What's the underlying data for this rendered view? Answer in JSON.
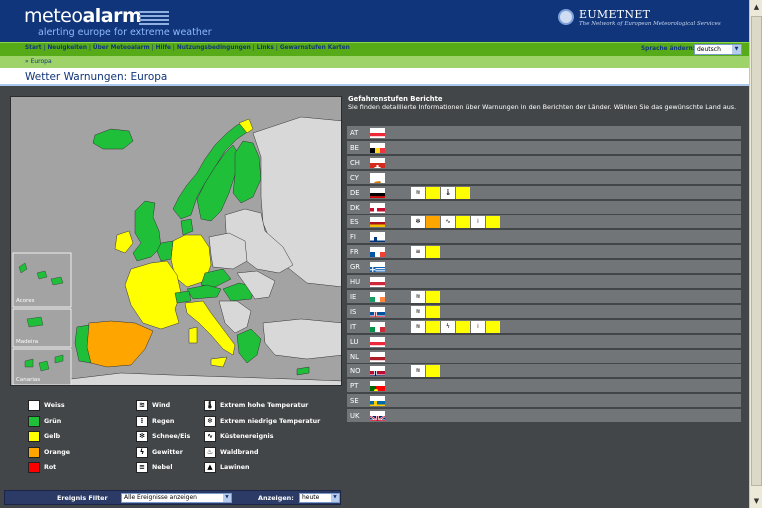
{
  "header": {
    "logo_part1": "meteo",
    "logo_part2": "alarm",
    "tagline": "alerting europe for extreme weather",
    "partner_name": "EUMETNET",
    "partner_sub": "The Network of European Meteorological Services"
  },
  "nav": {
    "items": [
      "Start",
      "Neuigkeiten",
      "Über Meteoalarm",
      "Hilfe",
      "Nutzungsbedingungen",
      "Links",
      "Gewarnstufen Karten"
    ],
    "language_label": "Sprache ändern:",
    "language_value": "deutsch"
  },
  "breadcrumb": "» Europa",
  "page_title": "Wetter Warnungen: Europa",
  "map": {
    "inset_labels": [
      "Acores",
      "Madeira",
      "Canarias"
    ]
  },
  "legend": {
    "levels": [
      {
        "label": "Weiss",
        "color": "#ffffff"
      },
      {
        "label": "Grün",
        "color": "#1fbf3a"
      },
      {
        "label": "Gelb",
        "color": "#ffff00"
      },
      {
        "label": "Orange",
        "color": "#ffa500"
      },
      {
        "label": "Rot",
        "color": "#ff0000"
      }
    ],
    "events_col1": [
      {
        "label": "Wind",
        "icon": "wind-icon"
      },
      {
        "label": "Regen",
        "icon": "rain-icon"
      },
      {
        "label": "Schnee/Eis",
        "icon": "snow-ice-icon"
      },
      {
        "label": "Gewitter",
        "icon": "thunderstorm-icon"
      },
      {
        "label": "Nebel",
        "icon": "fog-icon"
      }
    ],
    "events_col2": [
      {
        "label": "Extrem hohe Temperatur",
        "icon": "high-temp-icon"
      },
      {
        "label": "Extrem niedrige Temperatur",
        "icon": "low-temp-icon"
      },
      {
        "label": "Küstenereignis",
        "icon": "coastal-icon"
      },
      {
        "label": "Waldbrand",
        "icon": "forest-fire-icon"
      },
      {
        "label": "Lawinen",
        "icon": "avalanche-icon"
      }
    ]
  },
  "filter": {
    "label": "Ereignis Filter",
    "value": "Alle Ereignisse anzeigen",
    "show_label": "Anzeigen:",
    "show_value": "heute"
  },
  "reports": {
    "title": "Gefahrenstufen Berichte",
    "description": "Sie finden detaillierte Informationen über Warnungen in den Berichten der Länder. Wählen Sie das gewünschte Land aus.",
    "countries": [
      {
        "code": "AT",
        "flag": "austria-flag",
        "warnings": []
      },
      {
        "code": "BE",
        "flag": "belgium-flag",
        "warnings": []
      },
      {
        "code": "CH",
        "flag": "switzerland-flag",
        "warnings": []
      },
      {
        "code": "CY",
        "flag": "cyprus-flag",
        "warnings": []
      },
      {
        "code": "DE",
        "flag": "germany-flag",
        "warnings": [
          {
            "icon": "wind-icon",
            "level": "#ffff00"
          },
          {
            "icon": "high-temp-icon",
            "level": "#ffff00"
          }
        ]
      },
      {
        "code": "DK",
        "flag": "denmark-flag",
        "warnings": []
      },
      {
        "code": "ES",
        "flag": "spain-flag",
        "warnings": [
          {
            "icon": "snow-ice-icon",
            "level": "#ffa500"
          },
          {
            "icon": "coastal-icon",
            "level": "#ffff00"
          },
          {
            "icon": "rain-icon",
            "level": "#ffff00"
          }
        ]
      },
      {
        "code": "FI",
        "flag": "finland-flag",
        "warnings": []
      },
      {
        "code": "FR",
        "flag": "france-flag",
        "warnings": [
          {
            "icon": "fog-icon",
            "level": "#ffff00"
          }
        ]
      },
      {
        "code": "GR",
        "flag": "greece-flag",
        "warnings": []
      },
      {
        "code": "HU",
        "flag": "hungary-flag",
        "warnings": []
      },
      {
        "code": "IE",
        "flag": "ireland-flag",
        "warnings": [
          {
            "icon": "wind-icon",
            "level": "#ffff00"
          }
        ]
      },
      {
        "code": "IS",
        "flag": "iceland-flag",
        "warnings": [
          {
            "icon": "wind-icon",
            "level": "#ffff00"
          }
        ]
      },
      {
        "code": "IT",
        "flag": "italy-flag",
        "warnings": [
          {
            "icon": "wind-icon",
            "level": "#ffff00"
          },
          {
            "icon": "thunderstorm-icon",
            "level": "#ffff00"
          },
          {
            "icon": "rain-icon",
            "level": "#ffff00"
          }
        ]
      },
      {
        "code": "LU",
        "flag": "luxembourg-flag",
        "warnings": []
      },
      {
        "code": "NL",
        "flag": "netherlands-flag",
        "warnings": []
      },
      {
        "code": "NO",
        "flag": "norway-flag",
        "warnings": [
          {
            "icon": "wind-icon",
            "level": "#ffff00"
          }
        ]
      },
      {
        "code": "PT",
        "flag": "portugal-flag",
        "warnings": []
      },
      {
        "code": "SE",
        "flag": "sweden-flag",
        "warnings": []
      },
      {
        "code": "UK",
        "flag": "uk-flag",
        "warnings": []
      }
    ]
  }
}
